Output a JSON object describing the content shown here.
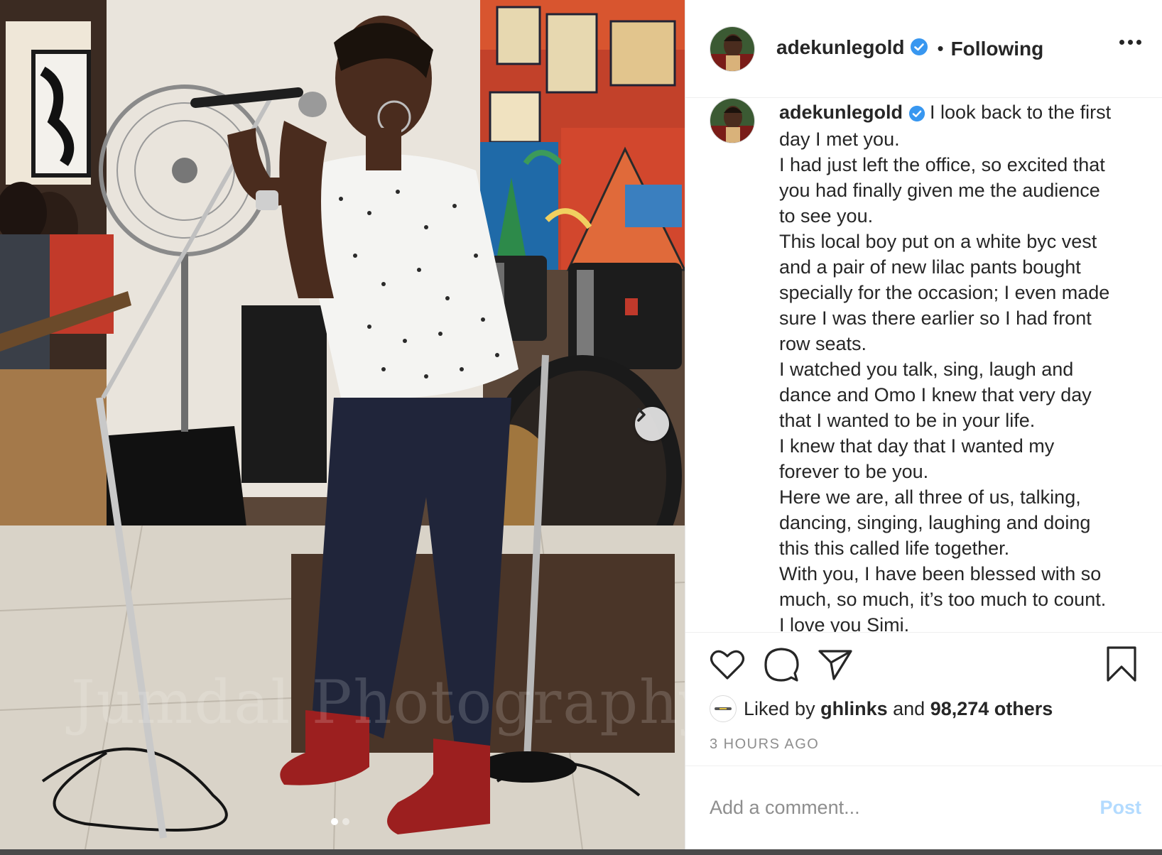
{
  "photo": {
    "watermark": "Jumdal Photography",
    "carousel": {
      "count": 2,
      "active": 1
    },
    "next_icon": "chevron-right-icon"
  },
  "header": {
    "username": "adekunlegold",
    "verified_icon": "verified-badge-icon",
    "separator": "•",
    "follow_label": "Following",
    "more_icon": "more-options-icon"
  },
  "caption": {
    "username": "adekunlegold",
    "lines": [
      "I look back to the first",
      "day I met you.",
      "I had just left the office, so excited that",
      "you had finally given me the audience",
      "to see you.",
      "This local boy put on a white byc vest",
      "and a pair of new lilac pants bought",
      "specially for the occasion; I even made",
      "sure I was there earlier so I had front",
      "row seats.",
      "I watched you talk, sing, laugh and",
      "dance and Omo I knew that very day",
      "that I wanted to be in your life.",
      "I knew that day that I wanted my",
      "forever to be you.",
      "Here we are, all three of us, talking,",
      "dancing, singing, laughing and doing",
      "this this called life together.",
      "With you, I have been blessed with so",
      "much, so much, it’s too much to count.",
      "I love you Simi."
    ]
  },
  "actions": {
    "like_icon": "heart-icon",
    "comment_icon": "comment-icon",
    "share_icon": "share-icon",
    "save_icon": "bookmark-icon"
  },
  "likes": {
    "prefix": "Liked by",
    "user": "ghlinks",
    "middle": "and",
    "count_text": "98,274 others"
  },
  "timestamp": "3 HOURS AGO",
  "comment": {
    "placeholder": "Add a comment...",
    "post_label": "Post"
  },
  "colors": {
    "text": "#262626",
    "muted": "#8e8e8e",
    "verified": "#3897f0",
    "post_disabled": "#b3dbff"
  }
}
